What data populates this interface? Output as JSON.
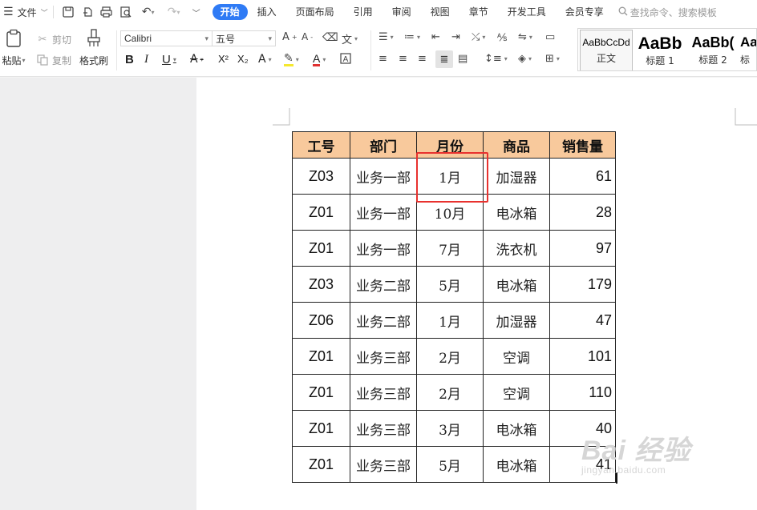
{
  "menubar": {
    "file_label": "文件",
    "tabs": [
      "开始",
      "插入",
      "页面布局",
      "引用",
      "审阅",
      "视图",
      "章节",
      "开发工具",
      "会员专享"
    ],
    "search_placeholder": "查找命令、搜索模板"
  },
  "ribbon": {
    "paste_label": "粘贴",
    "cut_label": "剪切",
    "copy_label": "复制",
    "format_painter_label": "格式刷",
    "font_name": "Calibri",
    "font_size": "五号",
    "styles": [
      {
        "preview": "AaBbCcDd",
        "label": "正文"
      },
      {
        "preview": "AaBb",
        "label": "标题 1"
      },
      {
        "preview": "AaBb(",
        "label": "标题 2"
      },
      {
        "preview": "Aa",
        "label": "标"
      }
    ]
  },
  "table": {
    "headers": [
      "工号",
      "部门",
      "月份",
      "商品",
      "销售量"
    ],
    "rows": [
      [
        "Z03",
        "业务一部",
        "1月",
        "加湿器",
        "61"
      ],
      [
        "Z01",
        "业务一部",
        "10月",
        "电冰箱",
        "28"
      ],
      [
        "Z01",
        "业务一部",
        "7月",
        "洗衣机",
        "97"
      ],
      [
        "Z03",
        "业务二部",
        "5月",
        "电冰箱",
        "179"
      ],
      [
        "Z06",
        "业务二部",
        "1月",
        "加湿器",
        "47"
      ],
      [
        "Z01",
        "业务三部",
        "2月",
        "空调",
        "101"
      ],
      [
        "Z01",
        "业务三部",
        "2月",
        "空调",
        "110"
      ],
      [
        "Z01",
        "业务三部",
        "3月",
        "电冰箱",
        "40"
      ],
      [
        "Z01",
        "业务三部",
        "5月",
        "电冰箱",
        "41"
      ]
    ],
    "header_color": "#f8c99c",
    "highlight_color": "#e8312e"
  },
  "watermark": {
    "line1": "Bai 经验",
    "line2": "jingyan.baidu.com"
  }
}
